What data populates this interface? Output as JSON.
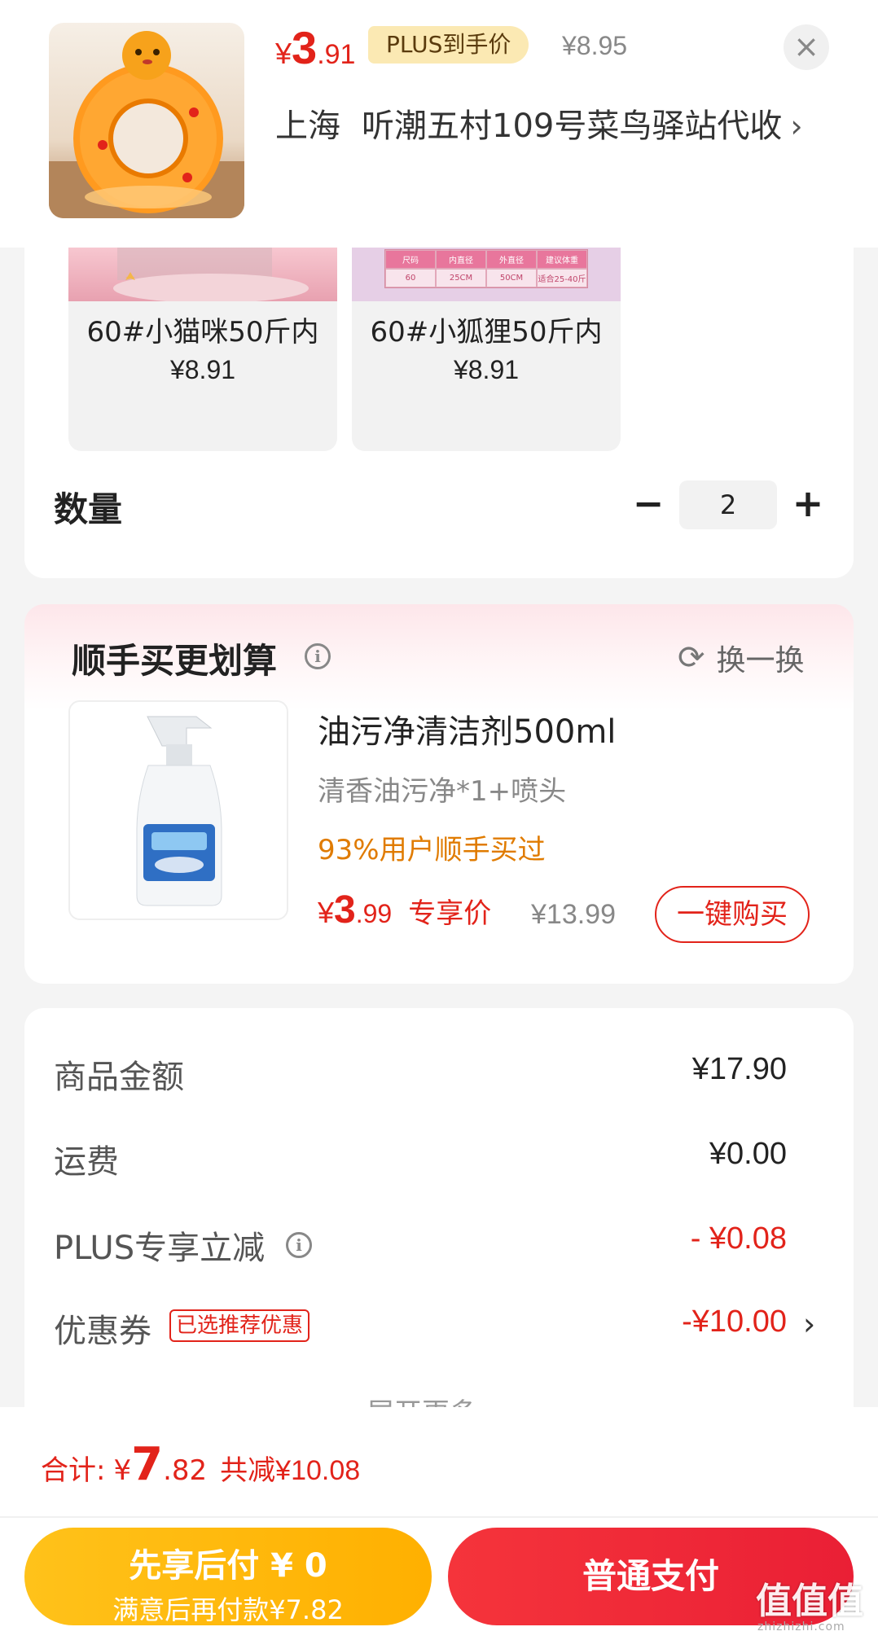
{
  "header": {
    "price_symbol": "¥",
    "price_integer": "3",
    "price_decimal": ".91",
    "plus_label": "PLUS到手价",
    "original_price": "¥8.95",
    "close_icon": "close-icon",
    "address_city": "上海",
    "address_detail": "听潮五村109号菜鸟驿站代收",
    "address_chevron": "›"
  },
  "specs": {
    "tiles": [
      {
        "name": "60#小猫咪50斤内",
        "price": "¥8.91"
      },
      {
        "name": "60#小狐狸50斤内",
        "price": "¥8.91"
      }
    ],
    "size_table": {
      "headers": [
        "尺码",
        "内直径",
        "外直径",
        "建议体重"
      ],
      "row": [
        "60",
        "25CM",
        "50CM",
        "适合25-40斤"
      ]
    },
    "quantity_label": "数量",
    "quantity_value": "2",
    "minus": "−",
    "plus": "+"
  },
  "addon": {
    "title": "顺手买更划算",
    "refresh_label": "换一换",
    "product_name": "油污净清洁剂500ml",
    "variant": "清香油污净*1+喷头",
    "social_proof": "93%用户顺手买过",
    "price_symbol": "¥",
    "price_integer": "3",
    "price_decimal": ".99",
    "price_tag": "专享价",
    "original_price": "¥13.99",
    "buy_button": "一键购买"
  },
  "summary": {
    "rows": [
      {
        "label": "商品金额",
        "value": "¥17.90"
      },
      {
        "label": "运费",
        "value": "¥0.00"
      },
      {
        "label": "PLUS专享立减",
        "value": "- ¥0.08"
      },
      {
        "label": "优惠券",
        "value": "-¥10.00"
      }
    ],
    "coupon_badge": "已选推荐优惠",
    "expand_more": "展开更多 ⌄"
  },
  "footer": {
    "total_label": "合计:",
    "total_symbol": "¥",
    "total_integer": "7",
    "total_decimal": ".82",
    "total_saved": "共减¥10.08",
    "pay_later_main": "先享后付 ¥ 0",
    "pay_later_sub": "满意后再付款¥7.82",
    "pay_normal": "普通支付",
    "watermark": "值值值",
    "watermark_url": "zhizhizhi.com"
  },
  "colors": {
    "accent_red": "#e2231a",
    "plus_gold": "#fbe9b3",
    "pay_later_yellow": "#ffb000",
    "social_orange": "#e07b00"
  }
}
